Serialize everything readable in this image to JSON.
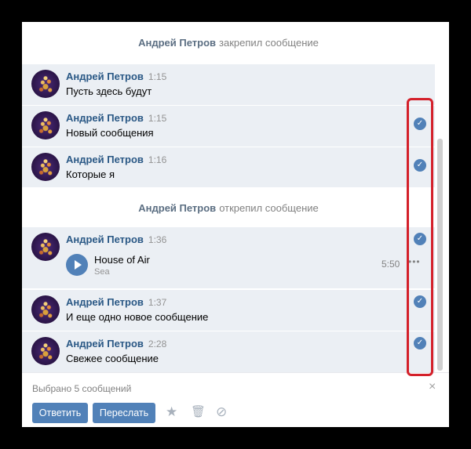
{
  "pin_notice": {
    "author": "Андрей Петров",
    "action": "закрепил сообщение"
  },
  "unpin_notice": {
    "author": "Андрей Петров",
    "action": "открепил сообщение"
  },
  "messages": [
    {
      "author": "Андрей Петров",
      "time": "1:15",
      "text": "Пусть здесь будут",
      "selected": false
    },
    {
      "author": "Андрей Петров",
      "time": "1:15",
      "text": "Новый сообщения",
      "selected": true
    },
    {
      "author": "Андрей Петров",
      "time": "1:16",
      "text": "Которые я",
      "selected": true
    },
    {
      "author": "Андрей Петров",
      "time": "1:36",
      "selected": true,
      "audio": {
        "title": "House of Air",
        "artist": "Sea",
        "duration": "5:50"
      }
    },
    {
      "author": "Андрей Петров",
      "time": "1:37",
      "text": "И еще одно новое сообщение",
      "selected": true
    },
    {
      "author": "Андрей Петров",
      "time": "2:28",
      "text": "Свежее сообщение",
      "selected": true
    }
  ],
  "footer": {
    "selected_label": "Выбрано 5 сообщений",
    "reply_label": "Ответить",
    "forward_label": "Переслать",
    "close_glyph": "×",
    "star_glyph": "★",
    "trash_glyph": "🗑",
    "spam_glyph": "⊘"
  },
  "check_glyph": "✓",
  "audio_more_glyph": "•••",
  "colors": {
    "accent": "#5181b8",
    "highlight": "#d4202a",
    "link": "#2a5885",
    "selected_bg": "#ebeff4"
  }
}
